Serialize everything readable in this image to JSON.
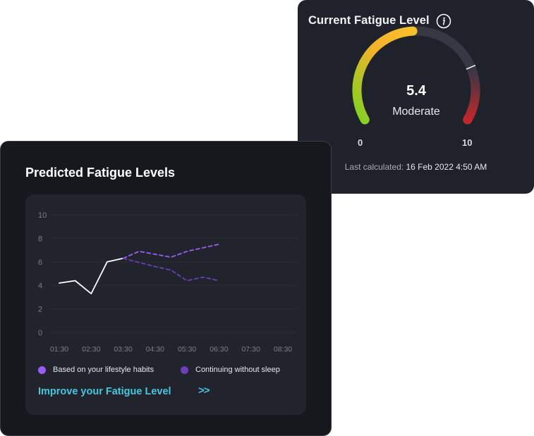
{
  "gauge_card": {
    "title": "Current Fatigue Level",
    "info_icon": "info-icon",
    "value": "5.4",
    "status": "Moderate",
    "min_label": "0",
    "max_label": "10",
    "min": 0,
    "max": 10,
    "fraction": 0.54,
    "last_calculated_label": "Last calculated:",
    "last_calculated_value": "16 Feb 2022 4:50 AM",
    "colors": {
      "track": "#363843",
      "gradient_low": "#7ed321",
      "gradient_mid": "#f6b12b",
      "gradient_high": "#c0282d"
    }
  },
  "predicted_card": {
    "title": "Predicted Fatigue Levels",
    "legend": [
      {
        "label": "Based on your lifestyle habits",
        "color": "#9b5cf6"
      },
      {
        "label": "Continuing without sleep",
        "color": "#6a3fb8"
      }
    ],
    "improve_link": "Improve your Fatigue Level",
    "improve_arrow": ">>"
  },
  "chart_data": {
    "type": "line",
    "x": [
      "01:30",
      "02:30",
      "03:30",
      "04:30",
      "05:30",
      "06:30",
      "07:30",
      "08:30"
    ],
    "ylim": [
      0,
      10
    ],
    "yticks": [
      "10",
      "8",
      "6",
      "4",
      "2",
      "0"
    ],
    "xlabel": "",
    "ylabel": "",
    "grid": true,
    "series": [
      {
        "style": "solid",
        "color": "#ffffff",
        "x": [
          "01:30",
          "02:00",
          "02:30",
          "03:00",
          "03:30"
        ],
        "values": [
          4.2,
          4.4,
          3.3,
          6.0,
          6.3
        ]
      },
      {
        "style": "dashed",
        "color": "#9b5cf6",
        "x": [
          "03:30",
          "04:00",
          "05:00",
          "05:30",
          "06:30"
        ],
        "values": [
          6.3,
          6.9,
          6.4,
          6.9,
          7.5
        ]
      },
      {
        "style": "dashed",
        "color": "#6a3fb8",
        "x": [
          "03:30",
          "04:30",
          "05:00",
          "05:30",
          "06:00",
          "06:30"
        ],
        "values": [
          6.3,
          5.6,
          5.3,
          4.4,
          4.7,
          4.4
        ]
      }
    ]
  }
}
